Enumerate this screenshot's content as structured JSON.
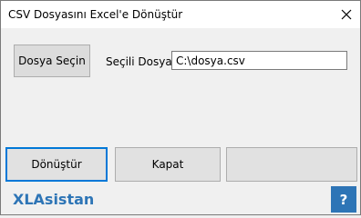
{
  "window": {
    "title": "CSV Dosyasını Excel'e Dönüştür",
    "close_icon": "close-icon"
  },
  "file_section": {
    "select_button_label": "Dosya Seçin",
    "selected_file_label": "Seçili Dosya:",
    "selected_file_value": "C:\\dosya.csv"
  },
  "actions": {
    "convert_label": "Dönüştür",
    "close_label": "Kapat",
    "empty_label": ""
  },
  "footer": {
    "brand": "XLAsistan",
    "help_label": "?"
  },
  "colors": {
    "brand": "#2e75b6",
    "focus_border": "#0078d7",
    "background": "#f0f0f0"
  }
}
